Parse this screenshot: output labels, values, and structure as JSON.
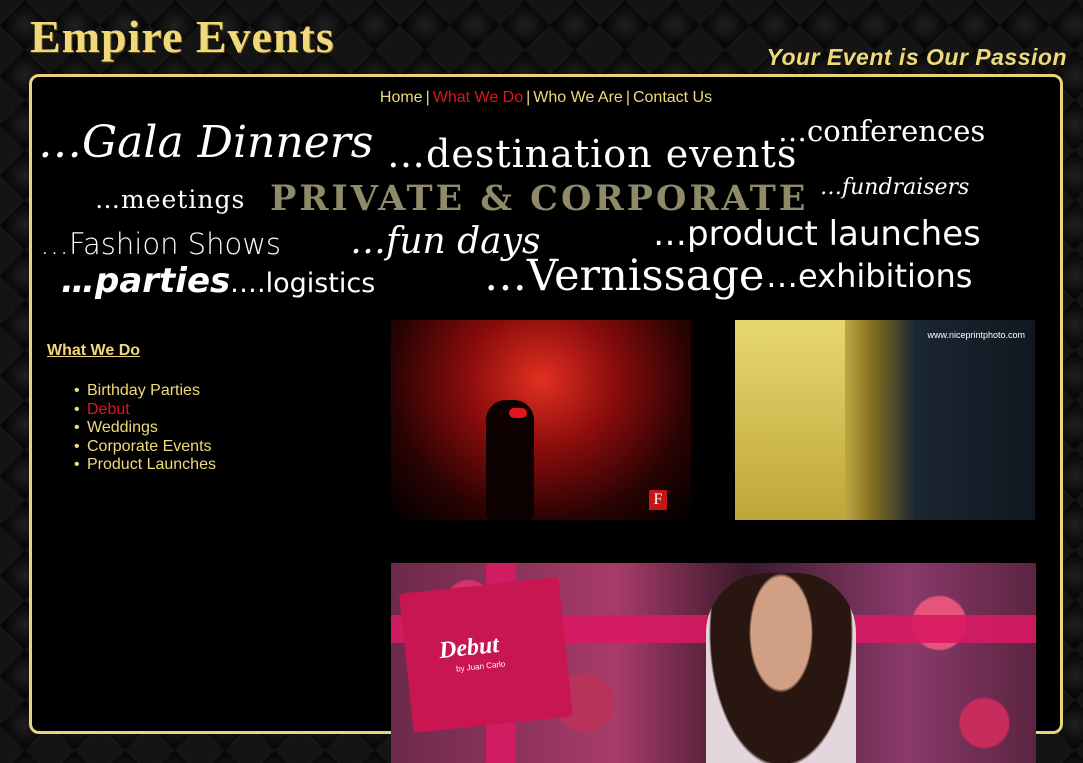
{
  "header": {
    "logo": "Empire Events",
    "tagline": "Your Event is Our Passion"
  },
  "nav": {
    "items": [
      {
        "label": "Home",
        "active": false
      },
      {
        "label": "What We Do",
        "active": true
      },
      {
        "label": "Who We Are",
        "active": false
      },
      {
        "label": "Contact Us",
        "active": false
      }
    ],
    "separator": "|"
  },
  "word_cloud": {
    "gala": "…Gala Dinners",
    "destination": "…destination events",
    "conferences": "…conferences",
    "meetings": "…meetings",
    "private_corporate": "PRIVATE & CORPORATE",
    "fundraisers": "…fundraisers",
    "fashion": "…Fashion Shows",
    "fun_days": "…fun days",
    "product_launches": "…product launches",
    "parties": "…parties",
    "logistics": "….logistics",
    "vernissage": "…Vernissage",
    "exhibitions": "…exhibitions"
  },
  "sidebar": {
    "title": "What We Do",
    "items": [
      {
        "label": "Birthday Parties",
        "active": false
      },
      {
        "label": "Debut",
        "active": true
      },
      {
        "label": "Weddings",
        "active": false
      },
      {
        "label": "Corporate Events",
        "active": false
      },
      {
        "label": "Product Launches",
        "active": false
      }
    ]
  },
  "photos": {
    "photo1_brand": "F",
    "photo2_watermark": "www.niceprintphoto.com",
    "photo3_title": "Debut",
    "photo3_sub": "by Juan Carlo"
  },
  "colors": {
    "gold": "#f0d97a",
    "active_red": "#e3141b",
    "frame_border": "#e9d47a"
  }
}
